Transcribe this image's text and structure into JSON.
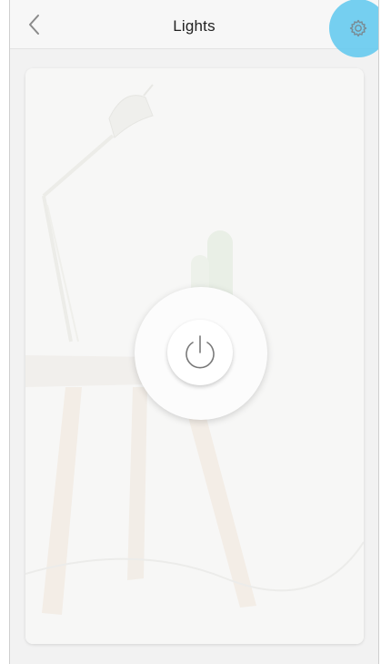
{
  "header": {
    "title": "Lights",
    "back_icon": "chevron-left-icon",
    "settings_icon": "gear-icon"
  },
  "main": {
    "power_icon": "power-icon",
    "background_scene": "desk-lamp-and-stool-photo"
  },
  "colors": {
    "accent_highlight": "#5ec8ef",
    "title_text": "#222222",
    "icon_gray": "#8a8a8a"
  }
}
